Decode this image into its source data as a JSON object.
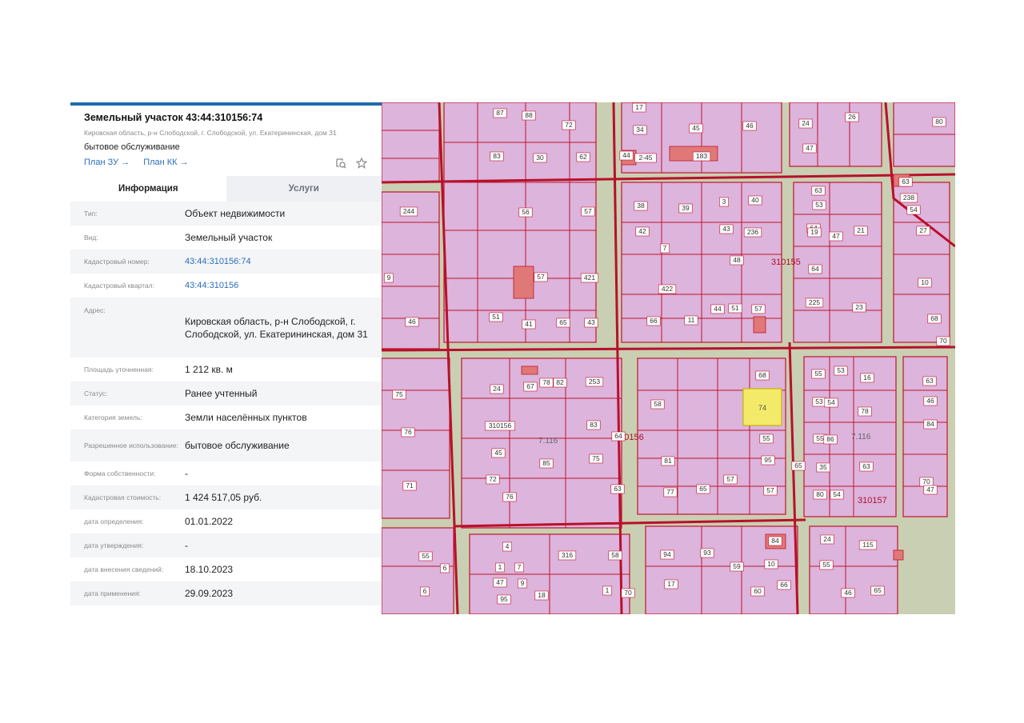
{
  "parcel": {
    "title": "Земельный участок 43:44:310156:74",
    "address_short": "Кировская область, р-н Слободской, г. Слободской, ул. Екатерининская, дом 31",
    "usage": "бытовое обслуживание",
    "link_plan_zu": "План ЗУ →",
    "link_plan_kk": "План КК →"
  },
  "tabs": {
    "info": "Информация",
    "services": "Услуги"
  },
  "info_rows": [
    {
      "label": "Тип:",
      "value": "Объект недвижимости"
    },
    {
      "label": "Вид:",
      "value": "Земельный участок"
    },
    {
      "label": "Кадастровый номер:",
      "value": "43:44:310156:74"
    },
    {
      "label": "Кадастровый квартал:",
      "value": "43:44:310156"
    },
    {
      "label": "Адрес:",
      "value": "Кировская область, р-н Слободской, г. Слободской, ул. Екатерининская, дом 31"
    },
    {
      "label": "Площадь уточненная:",
      "value": "1 212 кв. м"
    },
    {
      "label": "Статус:",
      "value": "Ранее учтенный"
    },
    {
      "label": "Категория земель:",
      "value": "Земли населённых пунктов"
    },
    {
      "label": "Разрешенное использование:",
      "value": "бытовое обслуживание"
    },
    {
      "label": "Форма собственности:",
      "value": "-"
    },
    {
      "label": "Кадастровая стоимость:",
      "value": "1 424 517,05 руб."
    },
    {
      "label": "дата определения:",
      "value": "01.01.2022"
    },
    {
      "label": "дата утверждения:",
      "value": "-"
    },
    {
      "label": "дата внесения сведений:",
      "value": "18.10.2023"
    },
    {
      "label": "дата применения:",
      "value": "29.09.2023"
    }
  ],
  "map": {
    "quarters": [
      "310155",
      "310156",
      "310157",
      "7.116",
      "7.116"
    ],
    "highlighted_parcel": "74",
    "parcel_labels": [
      "80",
      "87",
      "88",
      "17",
      "72",
      "26",
      "34",
      "45",
      "46",
      "24",
      "83",
      "30",
      "62",
      "44",
      "2-45",
      "183",
      "47",
      "63",
      "238",
      "244",
      "56",
      "57",
      "63",
      "38",
      "39",
      "3",
      "40",
      "53",
      "54",
      "64",
      "42",
      "43",
      "236",
      "19",
      "47",
      "21",
      "27",
      "7",
      "48",
      "64",
      "9",
      "57",
      "421",
      "422",
      "10",
      "46",
      "51",
      "41",
      "65",
      "43",
      "66",
      "11",
      "44",
      "51",
      "57",
      "225",
      "23",
      "68",
      "70",
      "75",
      "24",
      "67",
      "78",
      "82",
      "253",
      "68",
      "55",
      "53",
      "16",
      "63",
      "76",
      "58",
      "53",
      "54",
      "78",
      "46",
      "83",
      "310156",
      "64",
      "55",
      "55",
      "86",
      "84",
      "45",
      "85",
      "75",
      "81",
      "95",
      "65",
      "35",
      "63",
      "70",
      "71",
      "72",
      "76",
      "63",
      "77",
      "65",
      "57",
      "57",
      "80",
      "54",
      "47",
      "4",
      "316",
      "58",
      "84",
      "24",
      "115",
      "55",
      "6",
      "1",
      "7",
      "94",
      "93",
      "59",
      "10",
      "55",
      "6",
      "47",
      "9",
      "18",
      "1",
      "70",
      "17",
      "60",
      "66",
      "46",
      "65",
      "95"
    ],
    "colors": {
      "parcel_fill": "#dcb4dc",
      "parcel_border": "#c0152a",
      "background": "#c9cfb2",
      "building": "#e07878",
      "highlight": "#f3ea6a"
    }
  }
}
